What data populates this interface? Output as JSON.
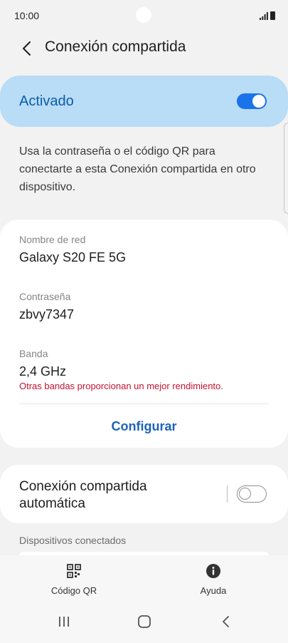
{
  "status_bar": {
    "time": "10:00"
  },
  "header": {
    "title": "Conexión compartida",
    "back_icon": "chevron-left-icon"
  },
  "master_switch": {
    "label": "Activado",
    "state": "on",
    "accent_color": "#1a73e8",
    "background_color": "#b9dcf7"
  },
  "description": "Usa la contraseña o el código QR para conectarte a esta Conexión compartida en otro dispositivo.",
  "network_info": {
    "name_label": "Nombre de red",
    "name_value": "Galaxy S20 FE 5G",
    "password_label": "Contraseña",
    "password_value": "zbvy7347",
    "band_label": "Banda",
    "band_value": "2,4 GHz",
    "band_warning": "Otras bandas proporcionan un mejor rendimiento.",
    "warning_color": "#c4122f",
    "configure_label": "Configurar"
  },
  "auto_hotspot": {
    "label": "Conexión compartida automática",
    "state": "off"
  },
  "connected_devices": {
    "header": "Dispositivos conectados"
  },
  "bottom_actions": [
    {
      "label": "Código QR",
      "icon": "qr-code-icon"
    },
    {
      "label": "Ayuda",
      "icon": "info-icon"
    }
  ],
  "nav_bar": {
    "recents_icon": "recents-icon",
    "home_icon": "home-icon",
    "back_icon": "back-icon"
  }
}
